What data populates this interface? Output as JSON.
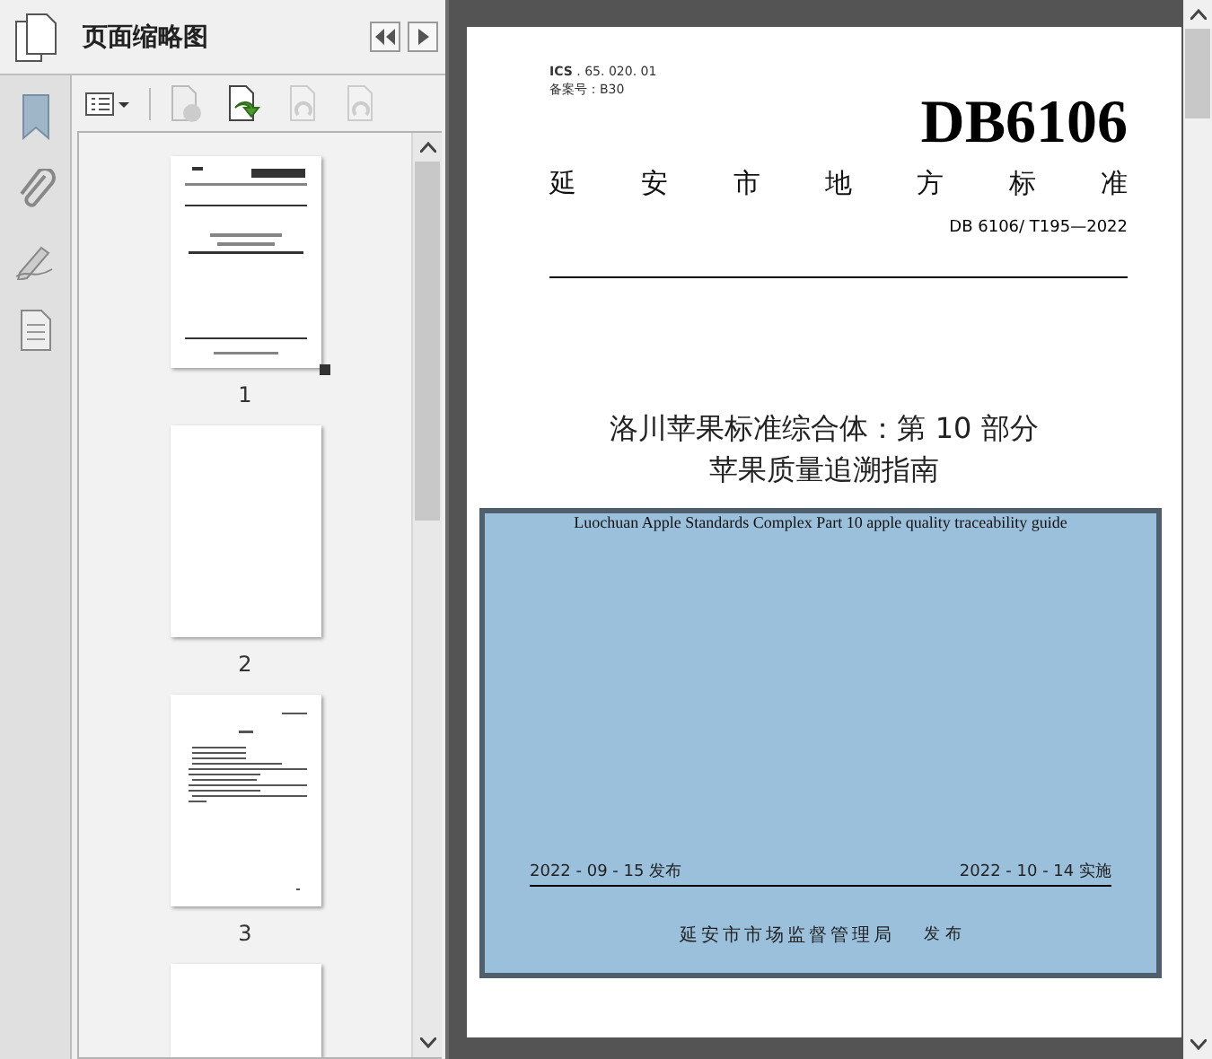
{
  "panel": {
    "title": "页面缩略图"
  },
  "thumbnails": [
    {
      "label": "1",
      "selected": true,
      "kind": "cover"
    },
    {
      "label": "2",
      "selected": false,
      "kind": "blank"
    },
    {
      "label": "3",
      "selected": false,
      "kind": "text"
    },
    {
      "kind": "blank"
    }
  ],
  "document": {
    "ics": "**ICS** . 65. 020. 01",
    "filing": "备案号：B30",
    "code": "DB6106",
    "category": [
      "延",
      "安",
      "市",
      "地",
      "方",
      "标",
      "准"
    ],
    "standard_number": "DB 6106/  T195—2022",
    "title_lines": [
      "洛川苹果标准综合体：第 10 部分",
      "苹果质量追溯指南"
    ],
    "english_title": "Luochuan Apple Standards Complex Part 10 apple quality traceability guide",
    "issue_date": "2022 - 09 - 15 发布",
    "effective_date": "2022 - 10 - 14 实施",
    "issuer": "延安市市场监督管理局",
    "issue_word": "发 布"
  }
}
